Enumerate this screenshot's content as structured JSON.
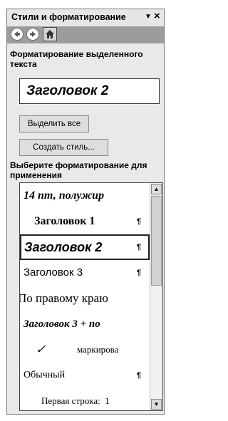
{
  "pane": {
    "title": "Стили и форматирование",
    "dropdown_icon": "▼",
    "close_icon": "×"
  },
  "nav": {
    "back": "back-arrow-icon",
    "forward": "forward-arrow-icon",
    "home": "home-icon"
  },
  "section1": {
    "heading": "Форматирование выделенного текста",
    "current_style": "Заголовок 2",
    "select_all_label": "Выделить все",
    "new_style_label": "Создать стиль..."
  },
  "section2": {
    "heading": "Выберите форматирование для применения"
  },
  "style_list": {
    "items": [
      {
        "label": "14 пт, полужир",
        "para_mark": ""
      },
      {
        "label": "Заголовок 1",
        "para_mark": "¶"
      },
      {
        "label": "Заголовок 2",
        "para_mark": "¶"
      },
      {
        "label": "Заголовок 3",
        "para_mark": "¶"
      },
      {
        "label": "По правому краю",
        "para_mark": ""
      },
      {
        "label": "Заголовок 3 + по",
        "para_mark": ""
      },
      {
        "check": "✓",
        "label": "маркирова",
        "para_mark": ""
      },
      {
        "label": "Обычный",
        "para_mark": "¶"
      },
      {
        "label": "Первая строка:  1",
        "para_mark": ""
      }
    ],
    "scroll_up": "▲",
    "scroll_down": "▼"
  }
}
